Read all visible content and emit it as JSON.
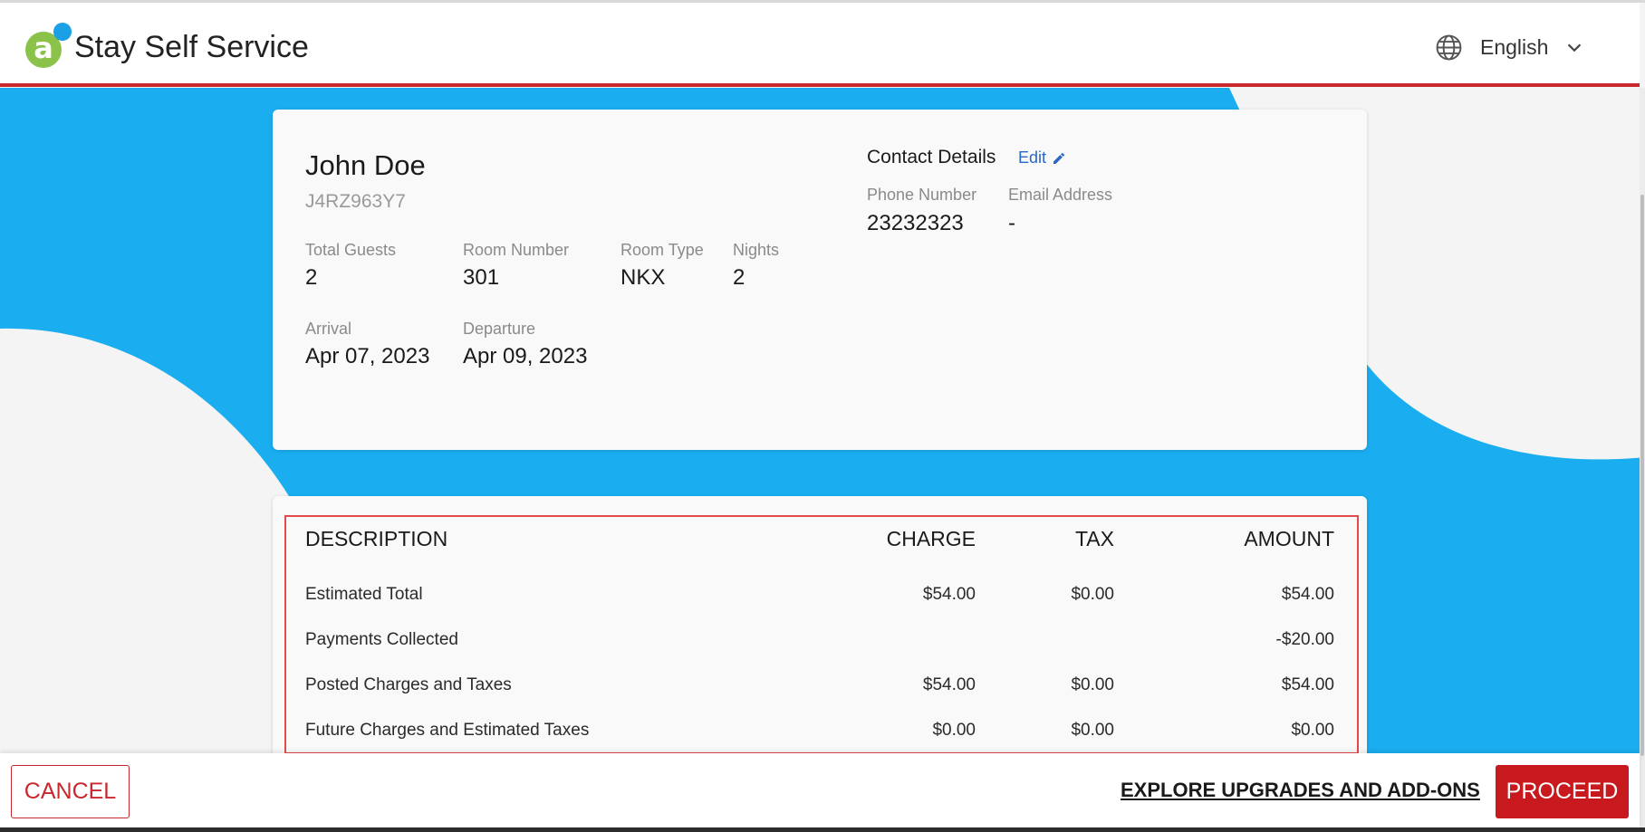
{
  "header": {
    "brand": "Stay Self Service",
    "logo_letter": "a",
    "language": "English",
    "icons": {
      "globe": "globe-icon",
      "chevron": "chevron-down-icon"
    }
  },
  "reservation": {
    "guest_name": "John Doe",
    "confirmation": "J4RZ963Y7",
    "total_guests_label": "Total Guests",
    "total_guests": "2",
    "room_number_label": "Room Number",
    "room_number": "301",
    "room_type_label": "Room Type",
    "room_type": "NKX",
    "nights_label": "Nights",
    "nights": "2",
    "arrival_label": "Arrival",
    "arrival": "Apr 07, 2023",
    "departure_label": "Departure",
    "departure": "Apr 09, 2023"
  },
  "contact": {
    "title": "Contact Details",
    "edit_label": "Edit",
    "phone_label": "Phone Number",
    "phone": "23232323",
    "email_label": "Email Address",
    "email": "-"
  },
  "charges": {
    "headers": {
      "description": "DESCRIPTION",
      "charge": "CHARGE",
      "tax": "TAX",
      "amount": "AMOUNT"
    },
    "rows": [
      {
        "description": "Estimated Total",
        "charge": "$54.00",
        "tax": "$0.00",
        "amount": "$54.00"
      },
      {
        "description": "Payments Collected",
        "charge": "",
        "tax": "",
        "amount": "-$20.00"
      },
      {
        "description": "Posted Charges and Taxes",
        "charge": "$54.00",
        "tax": "$0.00",
        "amount": "$54.00"
      },
      {
        "description": "Future Charges and Estimated Taxes",
        "charge": "$0.00",
        "tax": "$0.00",
        "amount": "$0.00"
      }
    ]
  },
  "footer": {
    "cancel_label": "CANCEL",
    "upgrade_label": "EXPLORE UPGRADES AND ADD-ONS",
    "proceed_label": "PROCEED"
  },
  "colors": {
    "accent_red": "#c8282e",
    "background_blue": "#1aaef0",
    "logo_green": "#8bc34a",
    "link_blue": "#2a66c8"
  }
}
